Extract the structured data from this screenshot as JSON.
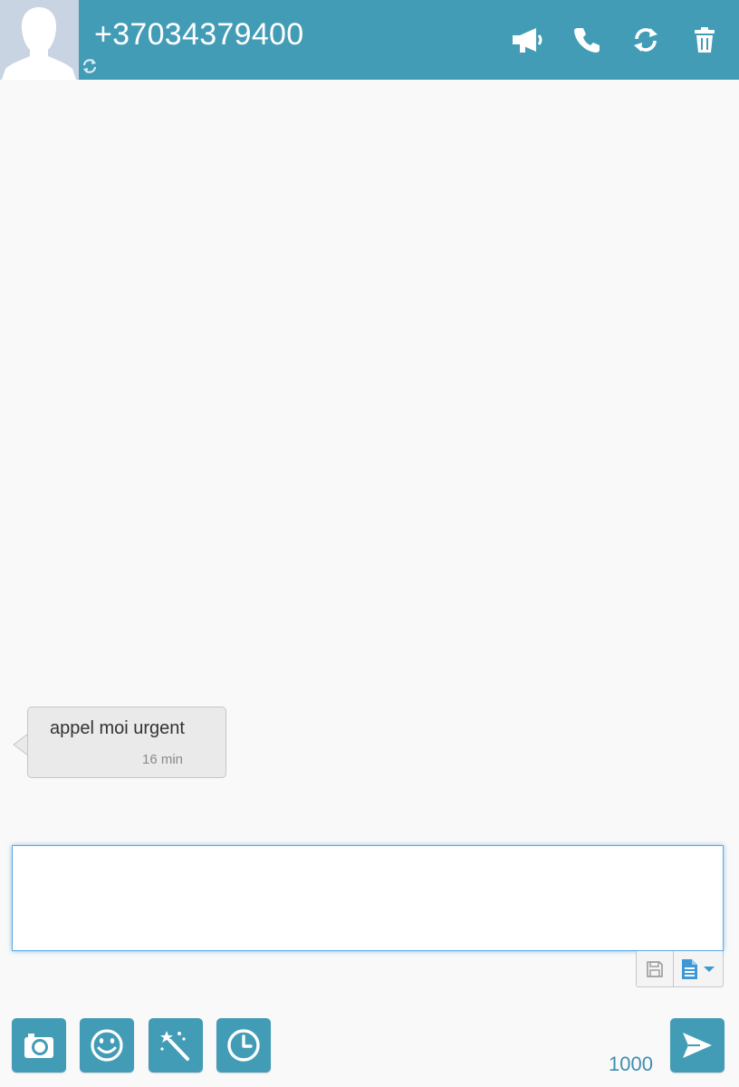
{
  "header": {
    "contact_number": "+37034379400"
  },
  "header_actions": [
    "megaphone-icon",
    "phone-icon",
    "refresh-icon",
    "trash-icon"
  ],
  "messages": [
    {
      "text": "appel moi urgent",
      "time": "16 min",
      "direction": "incoming"
    }
  ],
  "composer": {
    "value": "",
    "placeholder": "",
    "char_counter": "1000"
  },
  "composer_tools": [
    "save-icon",
    "template-document-icon"
  ],
  "bottom_toolbar": [
    "camera-icon",
    "smiley-icon",
    "magic-wand-icon",
    "clock-icon"
  ],
  "send_icon": "send-icon",
  "colors": {
    "accent": "#439cb6",
    "header_bg": "#439cb6",
    "bubble_bg": "#eaeaea",
    "page_bg": "#f9f9f9",
    "focus_border": "#5ba8e6",
    "counter_text": "#3d8fb0"
  }
}
